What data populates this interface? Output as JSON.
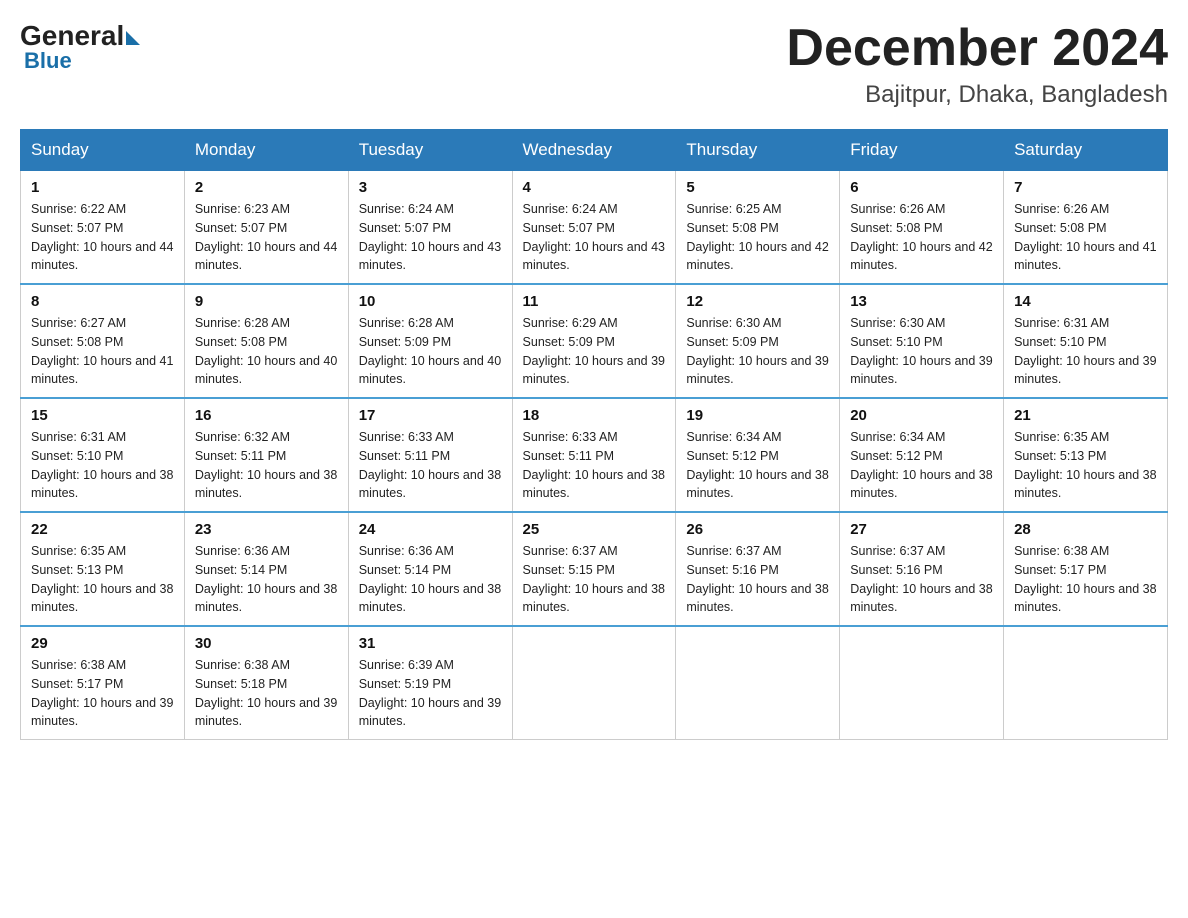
{
  "logo": {
    "general": "General",
    "blue": "Blue"
  },
  "title": "December 2024",
  "subtitle": "Bajitpur, Dhaka, Bangladesh",
  "days_of_week": [
    "Sunday",
    "Monday",
    "Tuesday",
    "Wednesday",
    "Thursday",
    "Friday",
    "Saturday"
  ],
  "weeks": [
    [
      {
        "day": "1",
        "sunrise": "6:22 AM",
        "sunset": "5:07 PM",
        "daylight": "10 hours and 44 minutes."
      },
      {
        "day": "2",
        "sunrise": "6:23 AM",
        "sunset": "5:07 PM",
        "daylight": "10 hours and 44 minutes."
      },
      {
        "day": "3",
        "sunrise": "6:24 AM",
        "sunset": "5:07 PM",
        "daylight": "10 hours and 43 minutes."
      },
      {
        "day": "4",
        "sunrise": "6:24 AM",
        "sunset": "5:07 PM",
        "daylight": "10 hours and 43 minutes."
      },
      {
        "day": "5",
        "sunrise": "6:25 AM",
        "sunset": "5:08 PM",
        "daylight": "10 hours and 42 minutes."
      },
      {
        "day": "6",
        "sunrise": "6:26 AM",
        "sunset": "5:08 PM",
        "daylight": "10 hours and 42 minutes."
      },
      {
        "day": "7",
        "sunrise": "6:26 AM",
        "sunset": "5:08 PM",
        "daylight": "10 hours and 41 minutes."
      }
    ],
    [
      {
        "day": "8",
        "sunrise": "6:27 AM",
        "sunset": "5:08 PM",
        "daylight": "10 hours and 41 minutes."
      },
      {
        "day": "9",
        "sunrise": "6:28 AM",
        "sunset": "5:08 PM",
        "daylight": "10 hours and 40 minutes."
      },
      {
        "day": "10",
        "sunrise": "6:28 AM",
        "sunset": "5:09 PM",
        "daylight": "10 hours and 40 minutes."
      },
      {
        "day": "11",
        "sunrise": "6:29 AM",
        "sunset": "5:09 PM",
        "daylight": "10 hours and 39 minutes."
      },
      {
        "day": "12",
        "sunrise": "6:30 AM",
        "sunset": "5:09 PM",
        "daylight": "10 hours and 39 minutes."
      },
      {
        "day": "13",
        "sunrise": "6:30 AM",
        "sunset": "5:10 PM",
        "daylight": "10 hours and 39 minutes."
      },
      {
        "day": "14",
        "sunrise": "6:31 AM",
        "sunset": "5:10 PM",
        "daylight": "10 hours and 39 minutes."
      }
    ],
    [
      {
        "day": "15",
        "sunrise": "6:31 AM",
        "sunset": "5:10 PM",
        "daylight": "10 hours and 38 minutes."
      },
      {
        "day": "16",
        "sunrise": "6:32 AM",
        "sunset": "5:11 PM",
        "daylight": "10 hours and 38 minutes."
      },
      {
        "day": "17",
        "sunrise": "6:33 AM",
        "sunset": "5:11 PM",
        "daylight": "10 hours and 38 minutes."
      },
      {
        "day": "18",
        "sunrise": "6:33 AM",
        "sunset": "5:11 PM",
        "daylight": "10 hours and 38 minutes."
      },
      {
        "day": "19",
        "sunrise": "6:34 AM",
        "sunset": "5:12 PM",
        "daylight": "10 hours and 38 minutes."
      },
      {
        "day": "20",
        "sunrise": "6:34 AM",
        "sunset": "5:12 PM",
        "daylight": "10 hours and 38 minutes."
      },
      {
        "day": "21",
        "sunrise": "6:35 AM",
        "sunset": "5:13 PM",
        "daylight": "10 hours and 38 minutes."
      }
    ],
    [
      {
        "day": "22",
        "sunrise": "6:35 AM",
        "sunset": "5:13 PM",
        "daylight": "10 hours and 38 minutes."
      },
      {
        "day": "23",
        "sunrise": "6:36 AM",
        "sunset": "5:14 PM",
        "daylight": "10 hours and 38 minutes."
      },
      {
        "day": "24",
        "sunrise": "6:36 AM",
        "sunset": "5:14 PM",
        "daylight": "10 hours and 38 minutes."
      },
      {
        "day": "25",
        "sunrise": "6:37 AM",
        "sunset": "5:15 PM",
        "daylight": "10 hours and 38 minutes."
      },
      {
        "day": "26",
        "sunrise": "6:37 AM",
        "sunset": "5:16 PM",
        "daylight": "10 hours and 38 minutes."
      },
      {
        "day": "27",
        "sunrise": "6:37 AM",
        "sunset": "5:16 PM",
        "daylight": "10 hours and 38 minutes."
      },
      {
        "day": "28",
        "sunrise": "6:38 AM",
        "sunset": "5:17 PM",
        "daylight": "10 hours and 38 minutes."
      }
    ],
    [
      {
        "day": "29",
        "sunrise": "6:38 AM",
        "sunset": "5:17 PM",
        "daylight": "10 hours and 39 minutes."
      },
      {
        "day": "30",
        "sunrise": "6:38 AM",
        "sunset": "5:18 PM",
        "daylight": "10 hours and 39 minutes."
      },
      {
        "day": "31",
        "sunrise": "6:39 AM",
        "sunset": "5:19 PM",
        "daylight": "10 hours and 39 minutes."
      },
      null,
      null,
      null,
      null
    ]
  ]
}
